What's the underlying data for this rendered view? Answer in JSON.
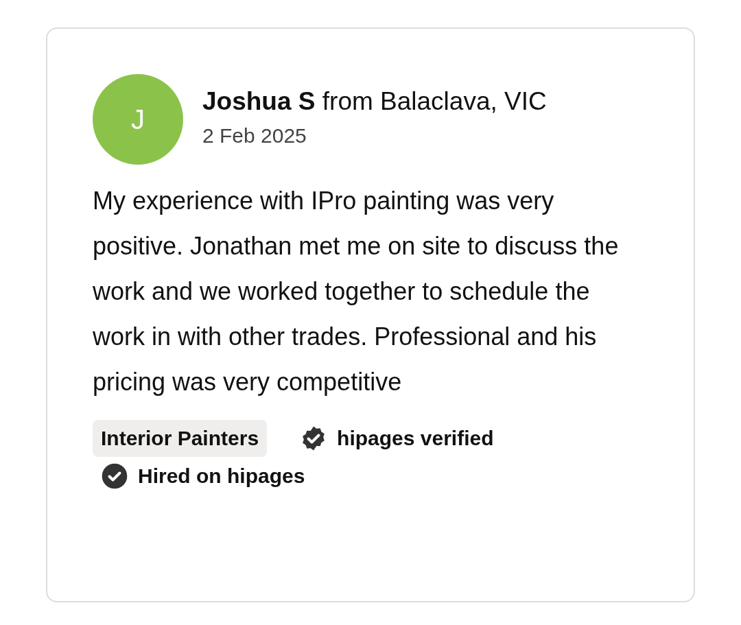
{
  "review": {
    "avatar_initial": "J",
    "author_line": "**Joshua S** from Balaclava, VIC",
    "date": "2 Feb 2025",
    "text": "My experience with IPro painting was very positive. Jonathan met me on site to discuss the work and we worked together to schedule the work in with other trades. Professional and his pricing was very competitive",
    "category": "Interior Painters",
    "badges": [
      {
        "kind": "verified",
        "label": "hipages verified"
      },
      {
        "kind": "hired",
        "label": "Hired on hipages"
      }
    ]
  }
}
